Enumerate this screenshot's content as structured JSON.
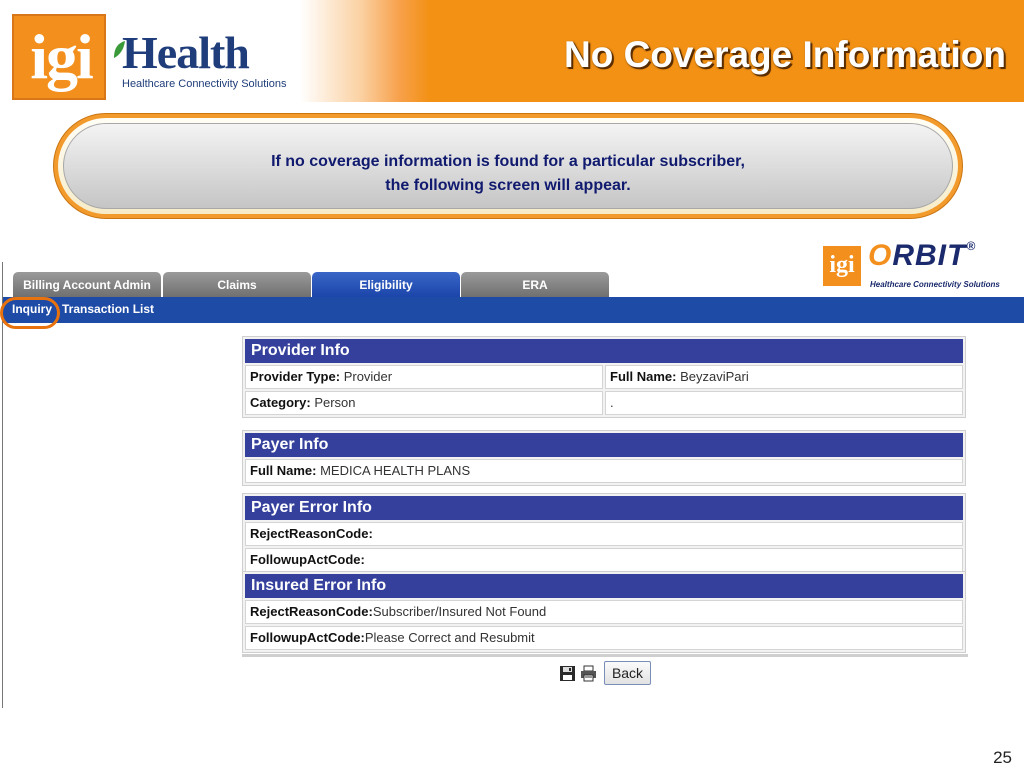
{
  "slide": {
    "title": "No Coverage Information",
    "page_number": "25"
  },
  "brand": {
    "logo_prefix": "igi",
    "logo_name": "Health",
    "tagline": "Healthcare Connectivity Solutions",
    "orbit_prefix": "igi",
    "orbit_name_o": "O",
    "orbit_name_rest": "RBIT",
    "orbit_reg": "®",
    "orbit_tagline": "Healthcare Connectivity Solutions"
  },
  "callout": {
    "line1": "If no coverage information is found for a particular subscriber,",
    "line2": "the following screen will appear."
  },
  "tabs": [
    {
      "label": "Billing Account Admin",
      "active": false
    },
    {
      "label": "Claims",
      "active": false
    },
    {
      "label": "Eligibility",
      "active": true
    },
    {
      "label": "ERA",
      "active": false
    }
  ],
  "subnav": {
    "inquiry": "Inquiry",
    "transaction_list": "Transaction List"
  },
  "provider_info": {
    "header": "Provider Info",
    "provider_type_label": "Provider Type:",
    "provider_type_value": "Provider",
    "full_name_label": "Full Name:",
    "full_name_value": "BeyzaviPari",
    "category_label": "Category:",
    "category_value": "Person",
    "extra_value": "."
  },
  "payer_info": {
    "header": "Payer Info",
    "full_name_label": "Full Name:",
    "full_name_value": "MEDICA HEALTH PLANS"
  },
  "payer_error_info": {
    "header": "Payer Error Info",
    "reject_label": "RejectReasonCode:",
    "reject_value": "",
    "followup_label": "FollowupActCode:",
    "followup_value": ""
  },
  "insured_error_info": {
    "header": "Insured Error Info",
    "reject_label": "RejectReasonCode:",
    "reject_value": "Subscriber/Insured Not Found",
    "followup_label": "FollowupActCode:",
    "followup_value": "Please Correct and Resubmit"
  },
  "actions": {
    "back_label": "Back",
    "save_icon": "floppy-disk-icon",
    "print_icon": "printer-icon"
  },
  "colors": {
    "brand_orange": "#f39114",
    "navy": "#1e4ba6",
    "section_header": "#34409c"
  }
}
